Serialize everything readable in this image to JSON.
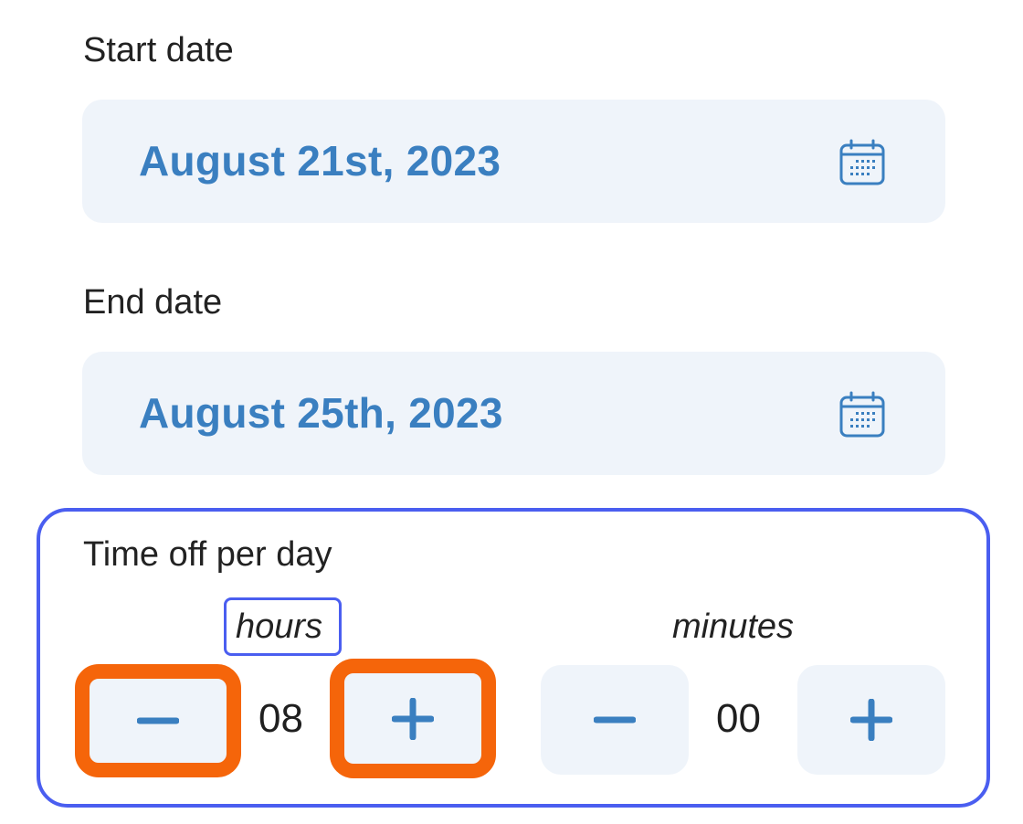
{
  "start_date": {
    "label": "Start date",
    "value": "August 21st, 2023",
    "icon": "calendar-icon"
  },
  "end_date": {
    "label": "End date",
    "value": "August 25th, 2023",
    "icon": "calendar-icon"
  },
  "time_off": {
    "label": "Time off per day",
    "hours": {
      "label": "hours",
      "value": "08",
      "decrement_icon": "minus-icon",
      "increment_icon": "plus-icon"
    },
    "minutes": {
      "label": "minutes",
      "value": "00",
      "decrement_icon": "minus-icon",
      "increment_icon": "plus-icon"
    }
  },
  "colors": {
    "accent": "#3a7fc0",
    "field_background": "#eff4fa",
    "focus_outline": "#4a5ef0",
    "highlight_outline": "#f5650a"
  }
}
